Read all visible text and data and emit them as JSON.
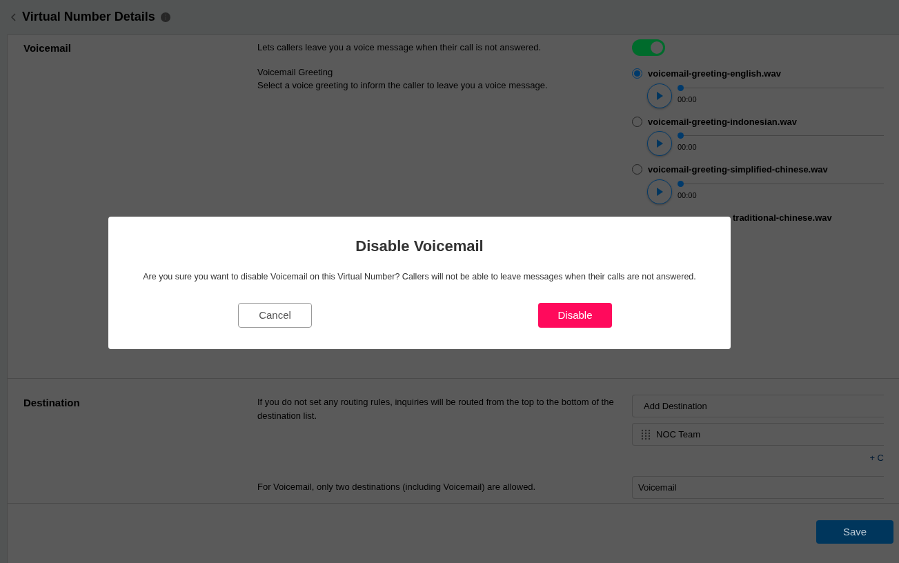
{
  "page": {
    "title": "Virtual Number Details"
  },
  "voicemail": {
    "label": "Voicemail",
    "description": "Lets callers leave you a voice message when their call is not answered.",
    "enabled": true,
    "greeting_title": "Voicemail Greeting",
    "greeting_hint": "Select a voice greeting to inform the caller to leave you a voice message.",
    "greetings": [
      {
        "kind": "full",
        "name": "voicemail-greeting-english.wav",
        "selected": true,
        "time": "00:00",
        "level": 0
      },
      {
        "kind": "full",
        "name": "voicemail-greeting-indonesian.wav",
        "selected": false,
        "time": "00:00",
        "level": 0
      },
      {
        "kind": "full",
        "name": "voicemail-greeting-simplified-chinese.wav",
        "selected": false,
        "time": "00:00",
        "level": 0
      },
      {
        "kind": "partial",
        "name": "traditional-chinese.wav"
      }
    ]
  },
  "destination": {
    "label": "Destination",
    "description": "If you do not set any routing rules, inquiries will be routed from the top to the bottom of the destination list.",
    "placeholder": "Add Destination",
    "items": [
      {
        "name": "NOC Team"
      }
    ],
    "add_link": "+ C",
    "note": "For Voicemail, only two destinations (including Voicemail) are allowed.",
    "fallback": "Voicemail"
  },
  "save": "Save",
  "dialog": {
    "title": "Disable Voicemail",
    "message": "Are you sure you want to disable Voicemail on this Virtual Number? Callers will not be able to leave messages when their calls are not answered.",
    "buttons": [
      {
        "kind": "secondary",
        "label": "Cancel"
      },
      {
        "kind": "danger",
        "label": "Disable"
      }
    ]
  }
}
